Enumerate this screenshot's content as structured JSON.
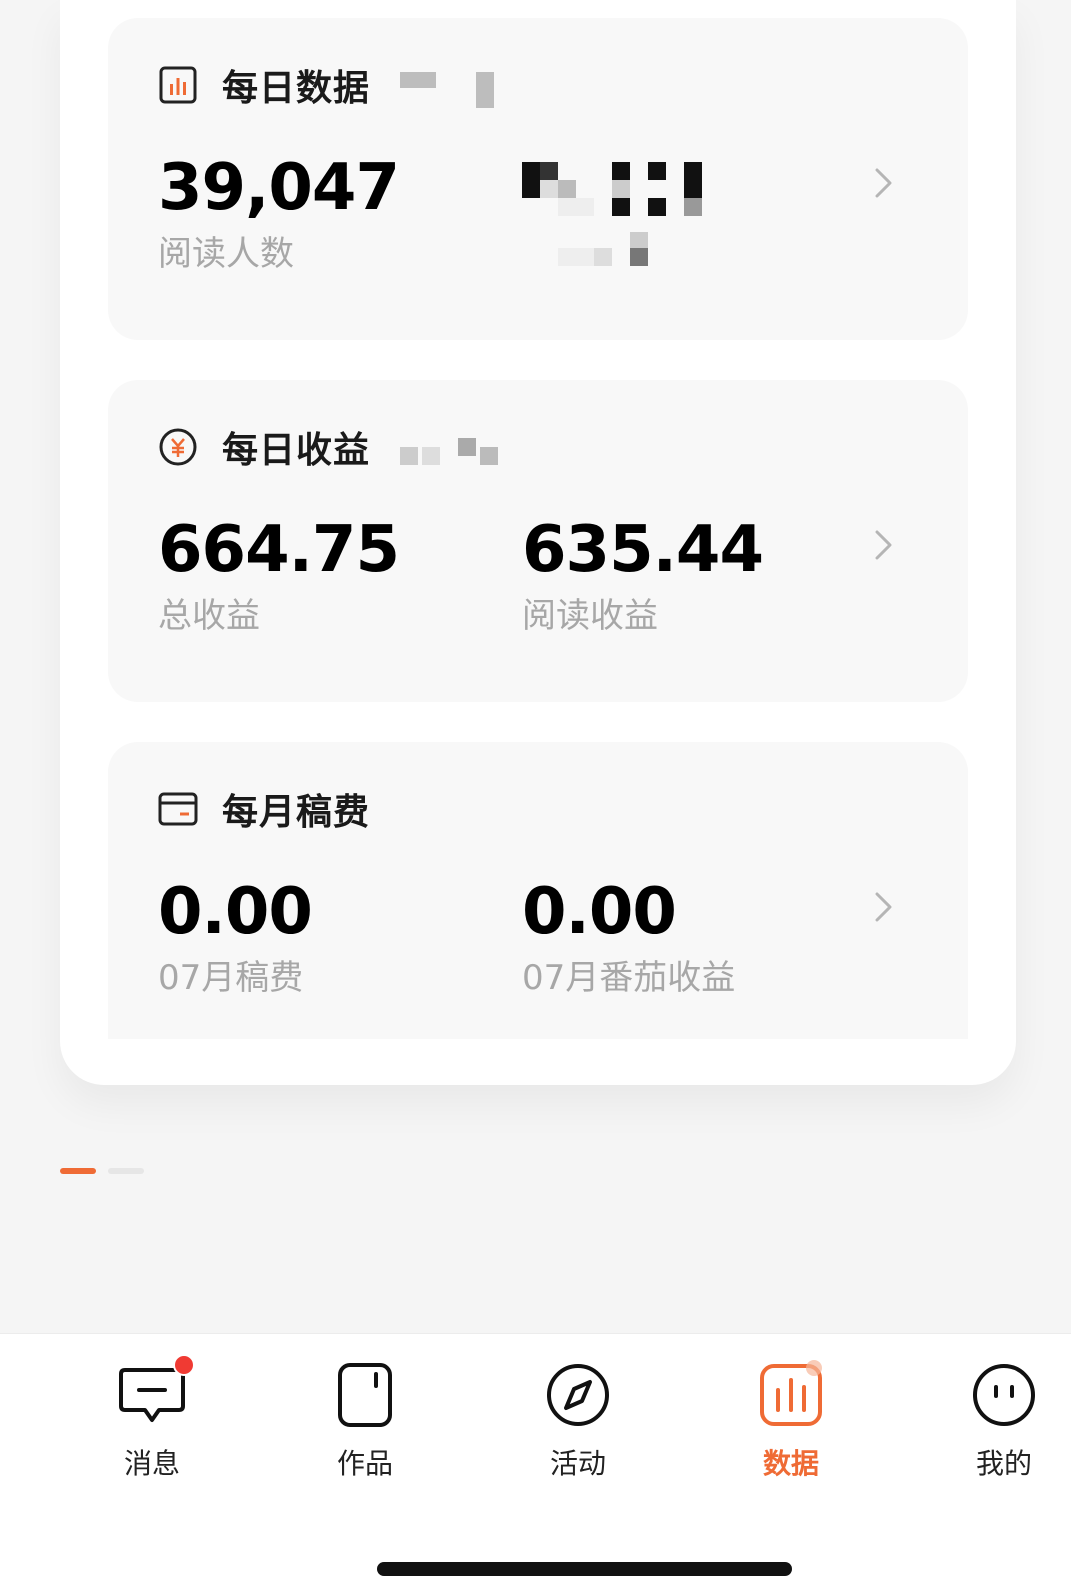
{
  "cards": [
    {
      "title": "每日数据",
      "left": {
        "value": "39,047",
        "label": "阅读人数"
      }
    },
    {
      "title": "每日收益",
      "left": {
        "value": "664.75",
        "label": "总收益"
      },
      "right": {
        "value": "635.44",
        "label": "阅读收益"
      }
    },
    {
      "title": "每月稿费",
      "left": {
        "value": "0.00",
        "label": "07月稿费"
      },
      "right": {
        "value": "0.00",
        "label": "07月番茄收益"
      }
    }
  ],
  "tabs": [
    {
      "label": "消息",
      "icon": "message-icon"
    },
    {
      "label": "作品",
      "icon": "works-icon"
    },
    {
      "label": "活动",
      "icon": "compass-icon"
    },
    {
      "label": "数据",
      "icon": "data-chart-icon",
      "active": true
    },
    {
      "label": "我的",
      "icon": "profile-face-icon"
    }
  ],
  "colors": {
    "accent": "#ef6b35",
    "badge": "#f03a33"
  }
}
